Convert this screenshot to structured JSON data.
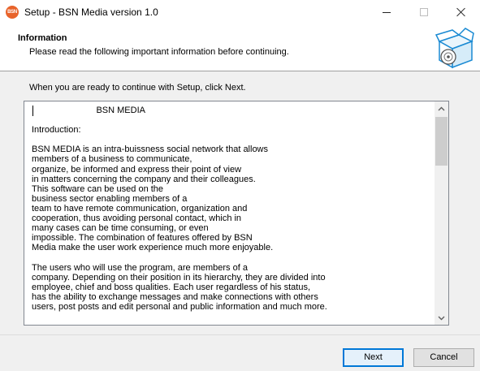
{
  "window": {
    "title": "Setup - BSN Media version 1.0",
    "icon_label": "BSN"
  },
  "header": {
    "title": "Information",
    "subtitle": "Please read the following important information before continuing."
  },
  "body": {
    "ready_text": "When you are ready to continue with Setup, click Next.",
    "info_text": "                          BSN MEDIA\n\nIntroduction:\n\nBSN MEDIA is an intra-buissness social network that allows\nmembers of a business to communicate,\norganize, be informed and express their point of view\nin matters concerning the company and their colleagues.\nThis software can be used on the\nbusiness sector enabling members of a\nteam to have remote communication, organization and\ncooperation, thus avoiding personal contact, which in\nmany cases can be time consuming, or even\nimpossible. The combination of features offered by BSN\nMedia make the user work experience much more enjoyable.\n\nThe users who will use the program, are members of a\ncompany. Depending on their position in its hierarchy, they are divided into\nemployee, chief and boss qualities. Each user regardless of his status,\nhas the ability to exchange messages and make connections with others\nusers, post posts and edit personal and public information and much more."
  },
  "buttons": {
    "next_label": "Next",
    "cancel_label": "Cancel"
  },
  "colors": {
    "accent": "#0078d7",
    "app_icon": "#e8632a"
  },
  "icons": [
    "app-icon",
    "minimize-icon",
    "maximize-icon",
    "close-icon",
    "setup-box-icon",
    "scroll-up-icon",
    "scroll-down-icon"
  ]
}
